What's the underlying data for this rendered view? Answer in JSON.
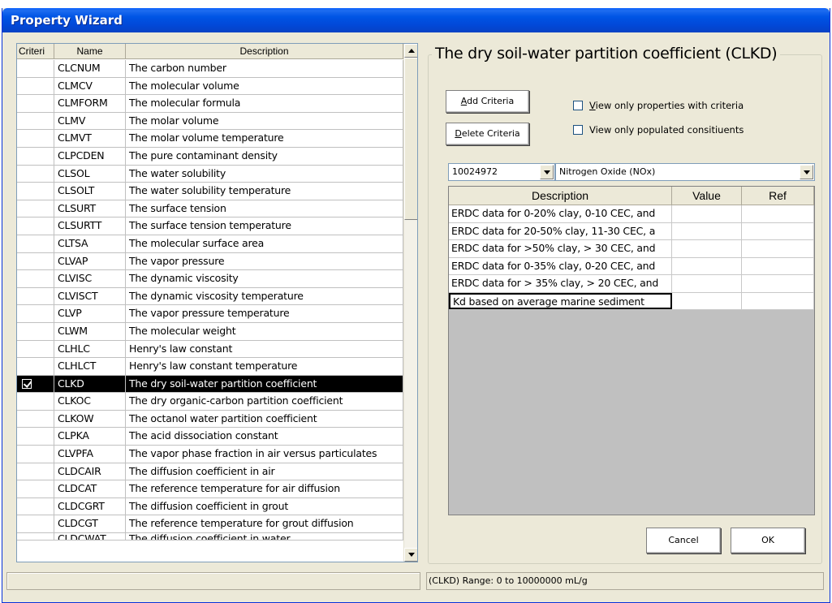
{
  "window": {
    "title": "Property Wizard"
  },
  "grid": {
    "headers": {
      "criteria": "Criteri",
      "name": "Name",
      "description": "Description"
    },
    "rows": [
      {
        "name": "CLCNUM",
        "description": "The carbon number",
        "checked": false
      },
      {
        "name": "CLMCV",
        "description": "The molecular volume",
        "checked": false
      },
      {
        "name": "CLMFORM",
        "description": "The molecular formula",
        "checked": false
      },
      {
        "name": "CLMV",
        "description": "The molar volume",
        "checked": false
      },
      {
        "name": "CLMVT",
        "description": "The molar volume temperature",
        "checked": false
      },
      {
        "name": "CLPCDEN",
        "description": "The pure contaminant density",
        "checked": false
      },
      {
        "name": "CLSOL",
        "description": "The water solubility",
        "checked": false
      },
      {
        "name": "CLSOLT",
        "description": "The water solubility temperature",
        "checked": false
      },
      {
        "name": "CLSURT",
        "description": "The surface tension",
        "checked": false
      },
      {
        "name": "CLSURTT",
        "description": "The surface tension temperature",
        "checked": false
      },
      {
        "name": "CLTSA",
        "description": "The molecular surface area",
        "checked": false
      },
      {
        "name": "CLVAP",
        "description": "The vapor pressure",
        "checked": false
      },
      {
        "name": "CLVISC",
        "description": "The dynamic viscosity",
        "checked": false
      },
      {
        "name": "CLVISCT",
        "description": "The dynamic viscosity temperature",
        "checked": false
      },
      {
        "name": "CLVP",
        "description": "The vapor pressure temperature",
        "checked": false
      },
      {
        "name": "CLWM",
        "description": "The molecular weight",
        "checked": false
      },
      {
        "name": "CLHLC",
        "description": "Henry's law constant",
        "checked": false
      },
      {
        "name": "CLHLCT",
        "description": "Henry's law constant temperature",
        "checked": false
      },
      {
        "name": "CLKD",
        "description": "The dry soil-water partition coefficient",
        "checked": true,
        "selected": true
      },
      {
        "name": "CLKOC",
        "description": "The dry organic-carbon partition coefficient",
        "checked": false
      },
      {
        "name": "CLKOW",
        "description": "The octanol water partition coefficient",
        "checked": false
      },
      {
        "name": "CLPKA",
        "description": "The acid dissociation constant",
        "checked": false
      },
      {
        "name": "CLVPFA",
        "description": "The vapor phase fraction in air versus particulates",
        "checked": false
      },
      {
        "name": "CLDCAIR",
        "description": "The diffusion coefficient in air",
        "checked": false
      },
      {
        "name": "CLDCAT",
        "description": "The reference temperature for air diffusion",
        "checked": false
      },
      {
        "name": "CLDCGRT",
        "description": "The diffusion coefficient in grout",
        "checked": false
      },
      {
        "name": "CLDCGT",
        "description": "The reference temperature for grout diffusion",
        "checked": false
      },
      {
        "name": "CLDCWAT",
        "description": "The diffusion coefficient in water",
        "checked": false,
        "partial": true
      }
    ]
  },
  "panel": {
    "title": "The dry soil-water partition coefficient (CLKD)",
    "add_criteria": {
      "accel": "A",
      "rest": "dd Criteria"
    },
    "delete_criteria": {
      "accel": "D",
      "rest": "elete Criteria"
    },
    "view_only_criteria": {
      "pre": "",
      "accel": "V",
      "rest": "iew only properties with criteria"
    },
    "view_only_populated": {
      "label": "View only populated consitiuents"
    },
    "constituent_id": "10024972",
    "constituent_name": "Nitrogen Oxide (NOx)",
    "prop_headers": {
      "description": "Description",
      "value": "Value",
      "ref": "Ref"
    },
    "prop_rows": [
      {
        "description": "ERDC data for 0-20% clay, 0-10 CEC, and",
        "value": "",
        "ref": ""
      },
      {
        "description": "ERDC data for 20-50% clay, 11-30 CEC, a",
        "value": "",
        "ref": ""
      },
      {
        "description": "ERDC data for >50% clay, > 30 CEC, and",
        "value": "",
        "ref": ""
      },
      {
        "description": "ERDC data for 0-35% clay, 0-20 CEC, and",
        "value": "",
        "ref": ""
      },
      {
        "description": "ERDC data for > 35% clay, > 20 CEC, and",
        "value": "",
        "ref": ""
      },
      {
        "description": "Kd based on average marine sediment",
        "value": "",
        "ref": "",
        "active": true
      }
    ],
    "cancel": "Cancel",
    "ok": "OK"
  },
  "status": {
    "left": "",
    "right": "(CLKD) Range: 0 to 10000000 mL/g"
  }
}
